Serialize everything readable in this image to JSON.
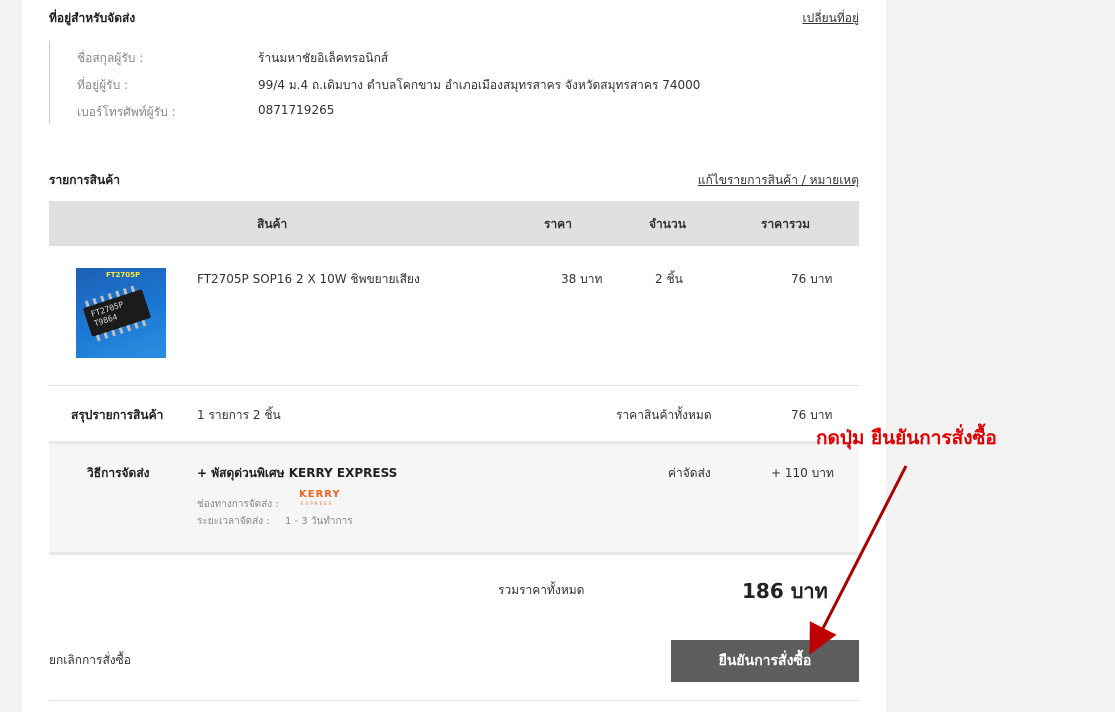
{
  "address": {
    "title": "ที่อยู่สำหรับจัดส่ง",
    "change_link": "เปลี่ยนที่อยู่",
    "name_label": "ชื่อสกุลผู้รับ :",
    "name_value": "ร้านมหาชัยอิเล็คทรอนิกส์",
    "addr_label": "ที่อยู่ผู้รับ :",
    "addr_value": "99/4 ม.4 ถ.เดิมบาง  ตำบลโคกขาม  อำเภอเมืองสมุทรสาคร  จังหวัดสมุทรสาคร  74000",
    "phone_label": "เบอร์โทรศัพท์ผู้รับ :",
    "phone_value": "0871719265"
  },
  "items": {
    "title": "รายการสินค้า",
    "edit_link": "แก้ไขรายการสินค้า / หมายเหตุ",
    "headers": {
      "product": "สินค้า",
      "price": "ราคา",
      "qty": "จำนวน",
      "total": "ราคารวม"
    },
    "rows": [
      {
        "image_caption": "FT2705P",
        "chip_marking": "FT2705P\nT9864",
        "name": "FT2705P SOP16 2 X 10W ชิพขยายเสียง",
        "price": "38 บาท",
        "qty": "2 ชิ้น",
        "total": "76 บาท"
      }
    ]
  },
  "summary": {
    "label": "สรุปรายการสินค้า",
    "count_text": "1 รายการ 2 ชิ้น",
    "subtotal_label": "ราคาสินค้าทั้งหมด",
    "subtotal_value": "76 บาท"
  },
  "shipping": {
    "label": "วิธีการจัดส่ง",
    "method": "+ พัสดุด่วนพิเศษ KERRY EXPRESS",
    "channel_label": "ช่องทางการจัดส่ง :",
    "carrier_logo": "KERRY",
    "carrier_logo_sub": "EXPRESS",
    "duration_label": "ระยะเวลาจัดส่ง :",
    "duration_value": "1 - 3 วันทำการ",
    "fee_label": "ค่าจัดส่ง",
    "fee_value": "+ 110 บาท"
  },
  "total": {
    "label": "รวมราคาทั้งหมด",
    "value": "186 บาท"
  },
  "actions": {
    "cancel": "ยกเลิกการสั่งซื้อ",
    "confirm": "ยืนยันการสั่งซื้อ"
  },
  "annotation": {
    "text": "กดปุ่ม ยืนยันการสั่งซื้อ",
    "color": "#e10000"
  }
}
